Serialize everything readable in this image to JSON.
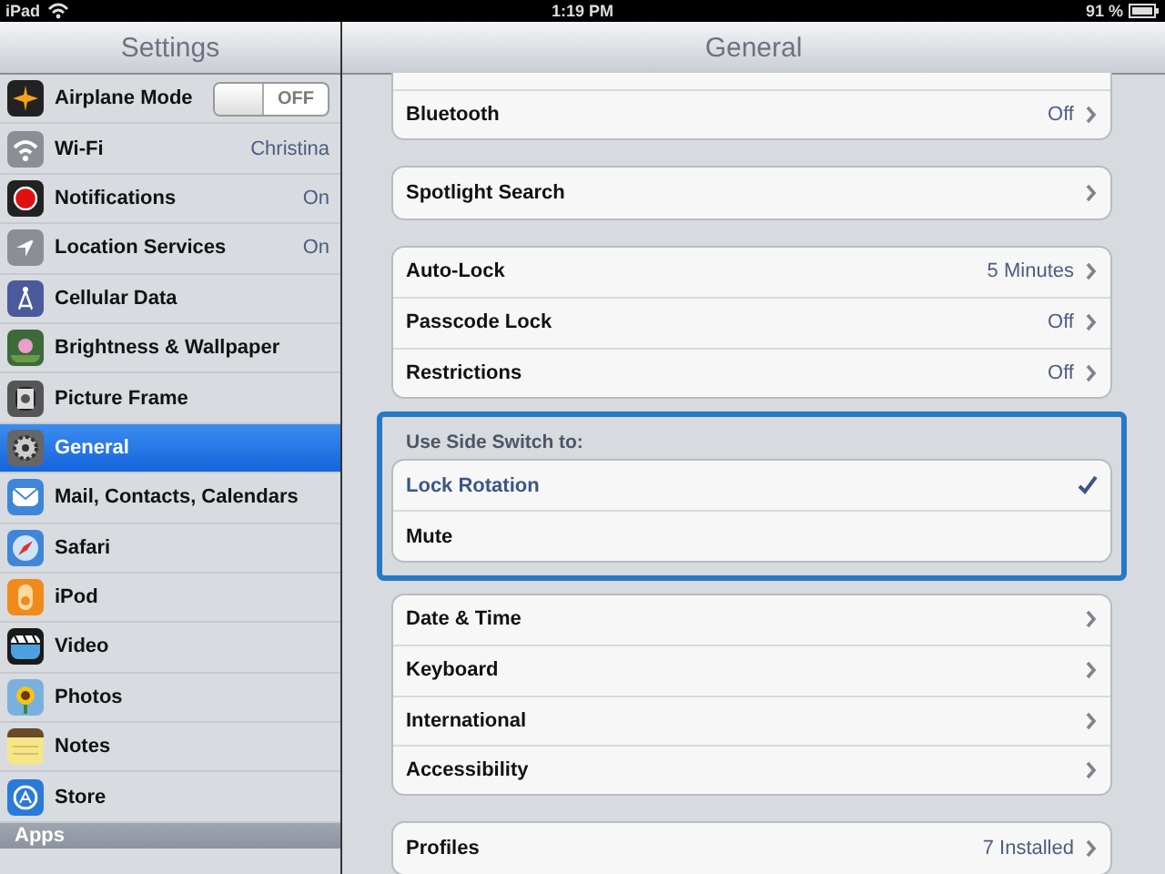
{
  "status_bar": {
    "device": "iPad",
    "time": "1:19 PM",
    "battery": "91 %"
  },
  "sidebar": {
    "title": "Settings",
    "items": [
      {
        "label": "Airplane Mode",
        "kind": "toggle",
        "on": false,
        "toggle_label": "OFF",
        "selected": false
      },
      {
        "label": "Wi-Fi",
        "kind": "value",
        "value": "Christina",
        "selected": false
      },
      {
        "label": "Notifications",
        "kind": "value",
        "value": "On",
        "selected": false
      },
      {
        "label": "Location Services",
        "kind": "value",
        "value": "On",
        "selected": false
      },
      {
        "label": "Cellular Data",
        "kind": "plain",
        "selected": false
      },
      {
        "label": "Brightness & Wallpaper",
        "kind": "plain",
        "selected": false
      },
      {
        "label": "Picture Frame",
        "kind": "plain",
        "selected": false
      },
      {
        "label": "General",
        "kind": "plain",
        "selected": true
      },
      {
        "label": "Mail, Contacts, Calendars",
        "kind": "plain",
        "selected": false
      },
      {
        "label": "Safari",
        "kind": "plain",
        "selected": false
      },
      {
        "label": "iPod",
        "kind": "plain",
        "selected": false
      },
      {
        "label": "Video",
        "kind": "plain",
        "selected": false
      },
      {
        "label": "Photos",
        "kind": "plain",
        "selected": false
      },
      {
        "label": "Notes",
        "kind": "plain",
        "selected": false
      },
      {
        "label": "Store",
        "kind": "plain",
        "selected": false
      }
    ],
    "section": "Apps"
  },
  "detail": {
    "title": "General",
    "groups": [
      {
        "kind": "continued",
        "rows": [
          {
            "label": "Bluetooth",
            "value": "Off"
          }
        ]
      },
      {
        "kind": "list",
        "rows": [
          {
            "label": "Spotlight Search"
          }
        ]
      },
      {
        "kind": "list",
        "rows": [
          {
            "label": "Auto-Lock",
            "value": "5 Minutes"
          },
          {
            "label": "Passcode Lock",
            "value": "Off"
          },
          {
            "label": "Restrictions",
            "value": "Off"
          }
        ]
      },
      {
        "kind": "choice",
        "header": "Use Side Switch to:",
        "focused": true,
        "rows": [
          {
            "label": "Lock Rotation",
            "selected": true
          },
          {
            "label": "Mute",
            "selected": false
          }
        ]
      },
      {
        "kind": "list",
        "rows": [
          {
            "label": "Date & Time"
          },
          {
            "label": "Keyboard"
          },
          {
            "label": "International"
          },
          {
            "label": "Accessibility"
          }
        ]
      },
      {
        "kind": "list",
        "rows": [
          {
            "label": "Profiles",
            "value": "7 Installed"
          }
        ]
      },
      {
        "kind": "edge"
      }
    ]
  }
}
